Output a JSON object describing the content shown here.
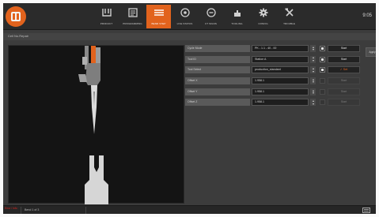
{
  "topbar": {
    "nav": [
      {
        "label": "PRODUCT",
        "icon": "product-icon",
        "active": false
      },
      {
        "label": "PROGRAMMING",
        "icon": "programming-icon",
        "active": false
      },
      {
        "label": "BEND STEP",
        "icon": "bend-step-icon",
        "active": true
      },
      {
        "label": "LIVE STATUS",
        "icon": "live-status-icon",
        "active": false
      },
      {
        "label": "CT SIGNS",
        "icon": "ct-signs-icon",
        "active": false
      },
      {
        "label": "TOOLING",
        "icon": "tooling-icon",
        "active": false
      },
      {
        "label": "CONFIG",
        "icon": "config-icon",
        "active": false
      },
      {
        "label": "TROUBLE",
        "icon": "trouble-icon",
        "active": false
      }
    ],
    "clock": "9:05"
  },
  "breadcrumb": "Cell No.Repair",
  "settings": {
    "rows": [
      {
        "label": "Cycle Mode",
        "value": "PK - 1.1 - 40 - 00",
        "checkbox": "checked",
        "button": "Start",
        "button_state": "normal"
      },
      {
        "label": "Tool ID",
        "value": "Station A",
        "checkbox": "checked",
        "button": "Start",
        "button_state": "normal"
      },
      {
        "label": "Tool Select",
        "value": "production_standard",
        "checkbox": "checked",
        "button": "✓ Set",
        "button_state": "accent"
      },
      {
        "label": "Offset X",
        "value": "1.958.1",
        "checkbox": "dim",
        "button": "Start",
        "button_state": "dim"
      },
      {
        "label": "Offset Y",
        "value": "1.958.1",
        "checkbox": "dim",
        "button": "Start",
        "button_state": "dim"
      },
      {
        "label": "Offset Z",
        "value": "1.958.1",
        "checkbox": "dim",
        "button": "Start",
        "button_state": "dim"
      }
    ],
    "side_button": "Apply"
  },
  "status": {
    "error": "Error / Info",
    "text": "Bend 1 of 3"
  },
  "colors": {
    "accent": "#e2631d",
    "panel": "#3c3c3c",
    "preview_bg": "#141414"
  }
}
